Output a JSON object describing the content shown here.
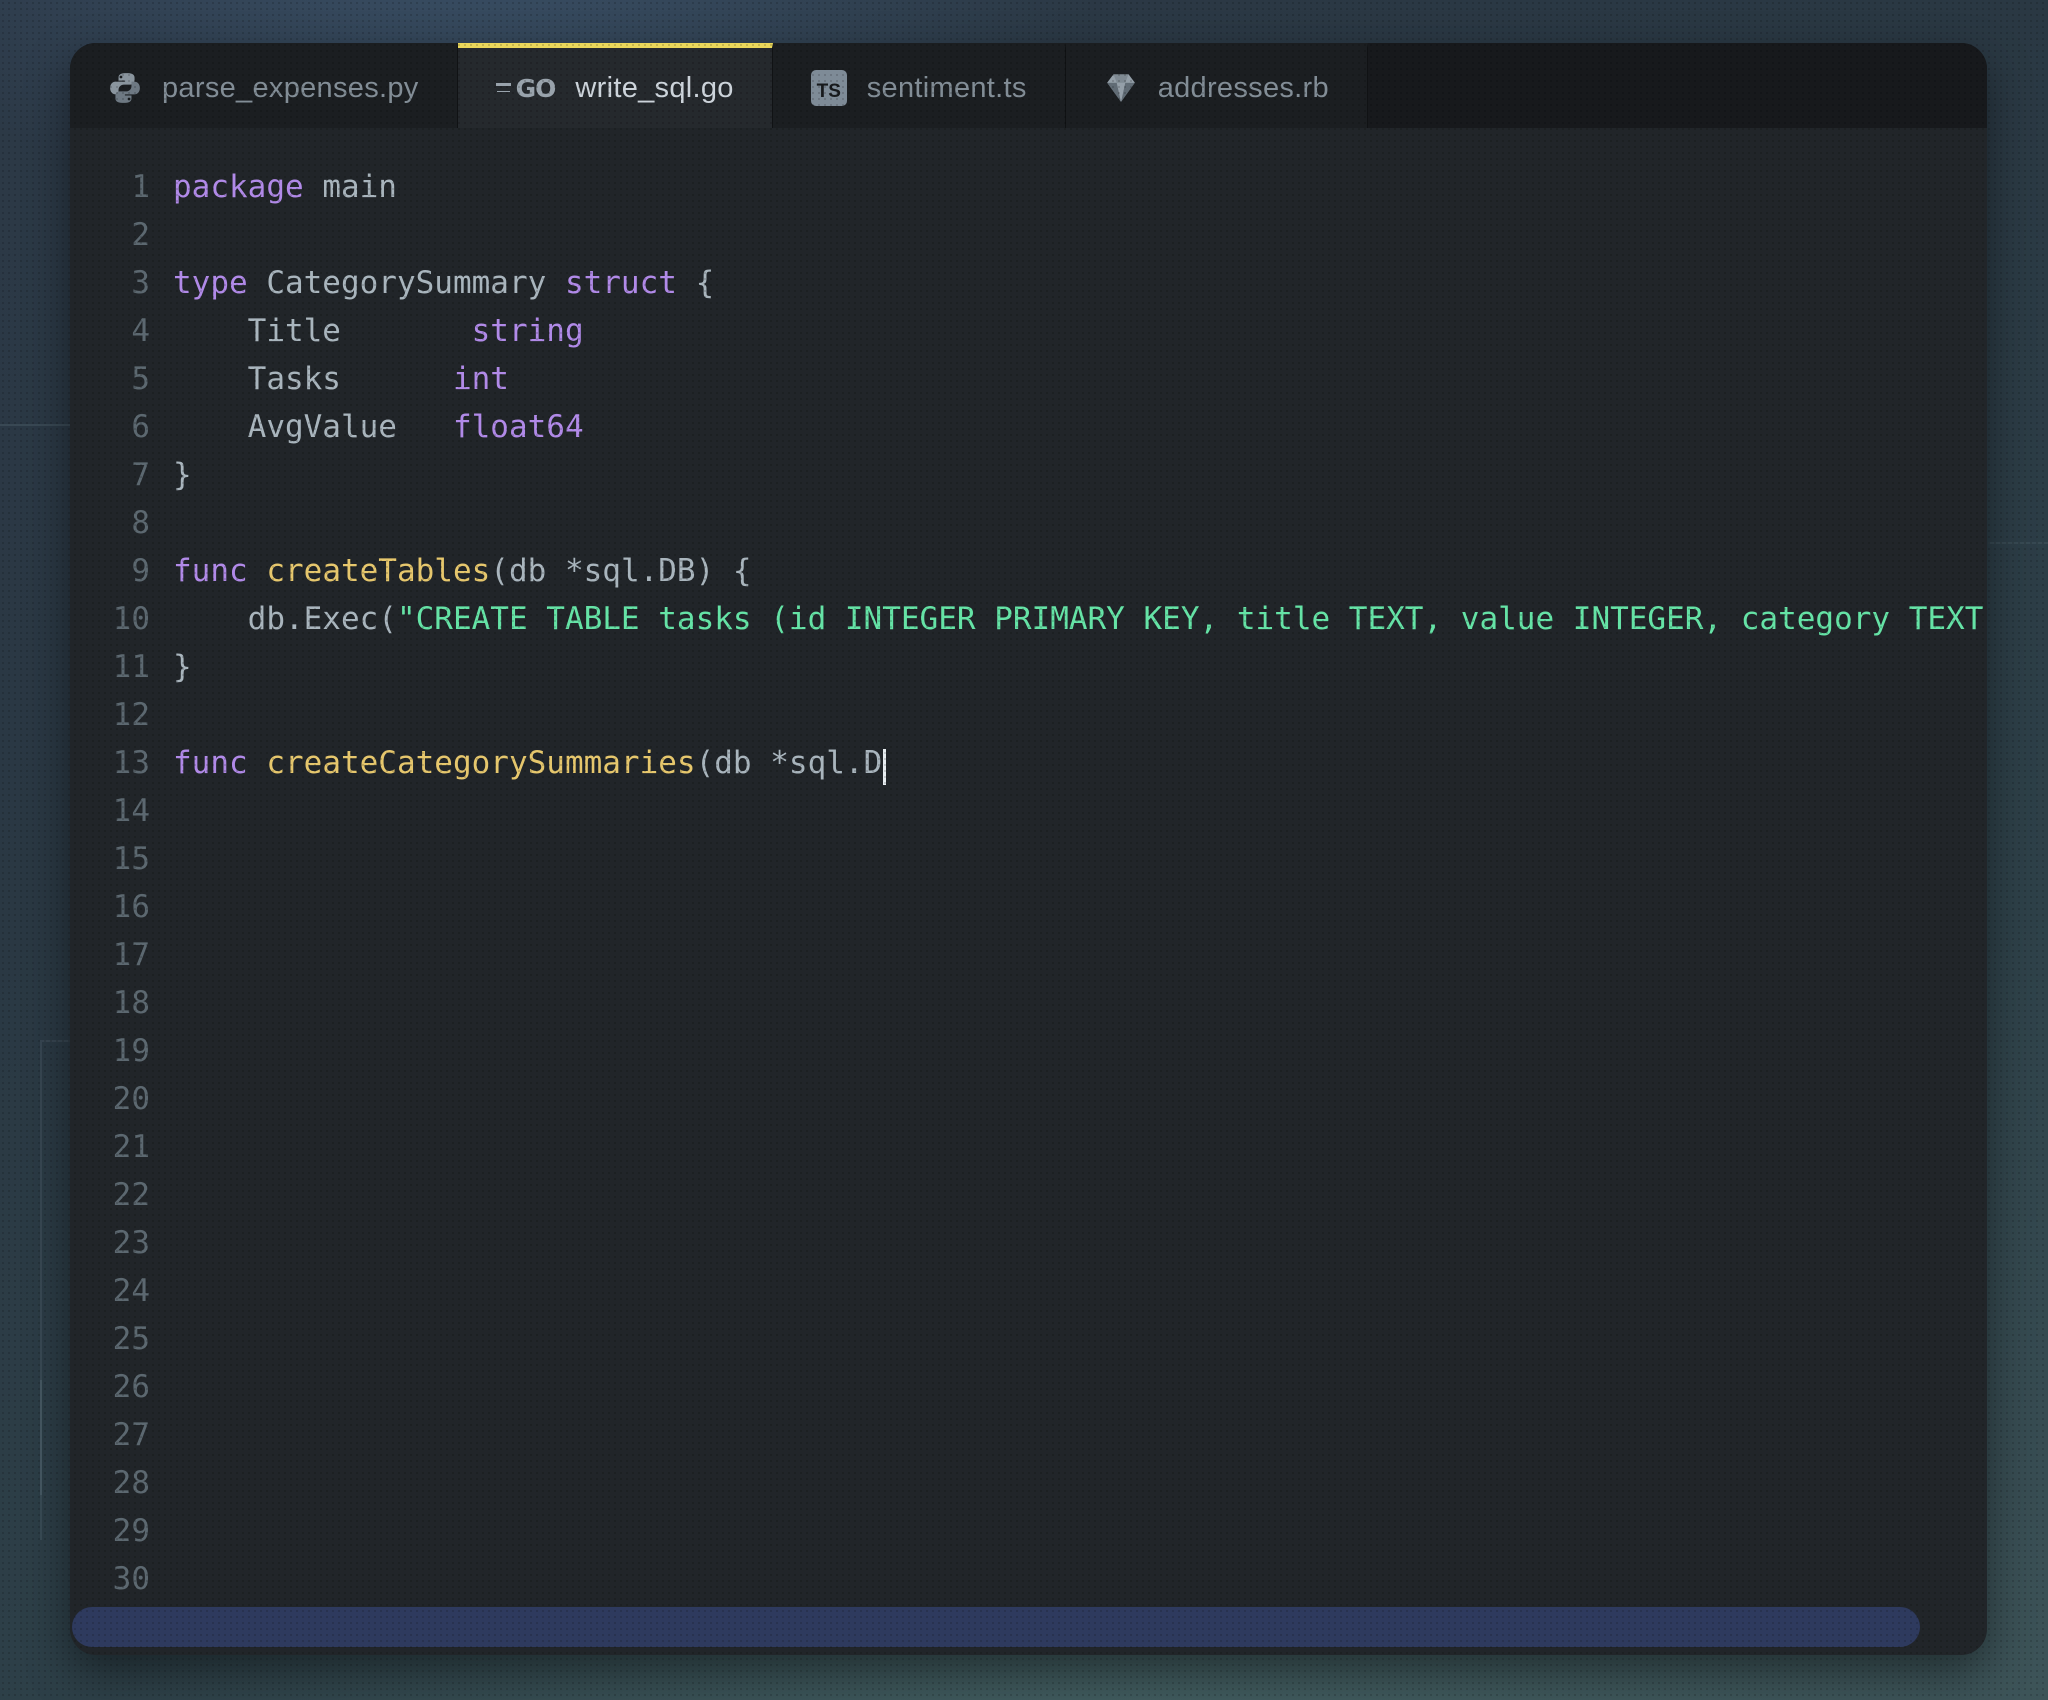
{
  "window": {
    "type": "code-editor"
  },
  "tabs": [
    {
      "label": "parse_expenses.py",
      "icon": "python-icon",
      "active": false
    },
    {
      "label": "write_sql.go",
      "icon": "go-icon",
      "active": true
    },
    {
      "label": "sentiment.ts",
      "icon": "typescript-icon",
      "active": false
    },
    {
      "label": "addresses.rb",
      "icon": "ruby-icon",
      "active": false
    }
  ],
  "editor": {
    "language": "go",
    "total_lines": 30,
    "cursor_line": 13,
    "lines": [
      {
        "n": 1,
        "tokens": [
          {
            "t": "package",
            "c": "keyword"
          },
          {
            "t": " main",
            "c": "plain"
          }
        ]
      },
      {
        "n": 2,
        "tokens": []
      },
      {
        "n": 3,
        "tokens": [
          {
            "t": "type",
            "c": "keyword"
          },
          {
            "t": " CategorySummary ",
            "c": "plain"
          },
          {
            "t": "struct",
            "c": "keyword"
          },
          {
            "t": " {",
            "c": "plain"
          }
        ]
      },
      {
        "n": 4,
        "tokens": [
          {
            "t": "    Title       ",
            "c": "plain"
          },
          {
            "t": "string",
            "c": "keyword"
          }
        ]
      },
      {
        "n": 5,
        "tokens": [
          {
            "t": "    Tasks      ",
            "c": "plain"
          },
          {
            "t": "int",
            "c": "keyword"
          }
        ]
      },
      {
        "n": 6,
        "tokens": [
          {
            "t": "    AvgValue   ",
            "c": "plain"
          },
          {
            "t": "float64",
            "c": "keyword"
          }
        ]
      },
      {
        "n": 7,
        "tokens": [
          {
            "t": "}",
            "c": "plain"
          }
        ]
      },
      {
        "n": 8,
        "tokens": []
      },
      {
        "n": 9,
        "tokens": [
          {
            "t": "func",
            "c": "keyword"
          },
          {
            "t": " ",
            "c": "plain"
          },
          {
            "t": "createTables",
            "c": "func"
          },
          {
            "t": "(db *sql.DB) {",
            "c": "plain"
          }
        ]
      },
      {
        "n": 10,
        "tokens": [
          {
            "t": "    db.Exec(",
            "c": "plain"
          },
          {
            "t": "\"CREATE TABLE tasks (id INTEGER PRIMARY KEY, title TEXT, value INTEGER, category TEXT",
            "c": "string"
          }
        ]
      },
      {
        "n": 11,
        "tokens": [
          {
            "t": "}",
            "c": "plain"
          }
        ]
      },
      {
        "n": 12,
        "tokens": []
      },
      {
        "n": 13,
        "tokens": [
          {
            "t": "func",
            "c": "keyword"
          },
          {
            "t": " ",
            "c": "plain"
          },
          {
            "t": "createCategorySummaries",
            "c": "func"
          },
          {
            "t": "(db *sql.D",
            "c": "plain"
          }
        ],
        "cursor": true
      }
    ]
  },
  "scrollbar": {
    "orientation": "horizontal",
    "thumb_color": "#2e3a5e"
  },
  "colors": {
    "active_tab_accent": "#ead75b",
    "editor_background": "#212529",
    "tabbar_background": "#17191c",
    "keyword": "#b18ae8",
    "function_name": "#e6c76d",
    "string_literal": "#65e3a6",
    "plain_code": "#a9b5bd",
    "line_number": "#5c6870"
  }
}
